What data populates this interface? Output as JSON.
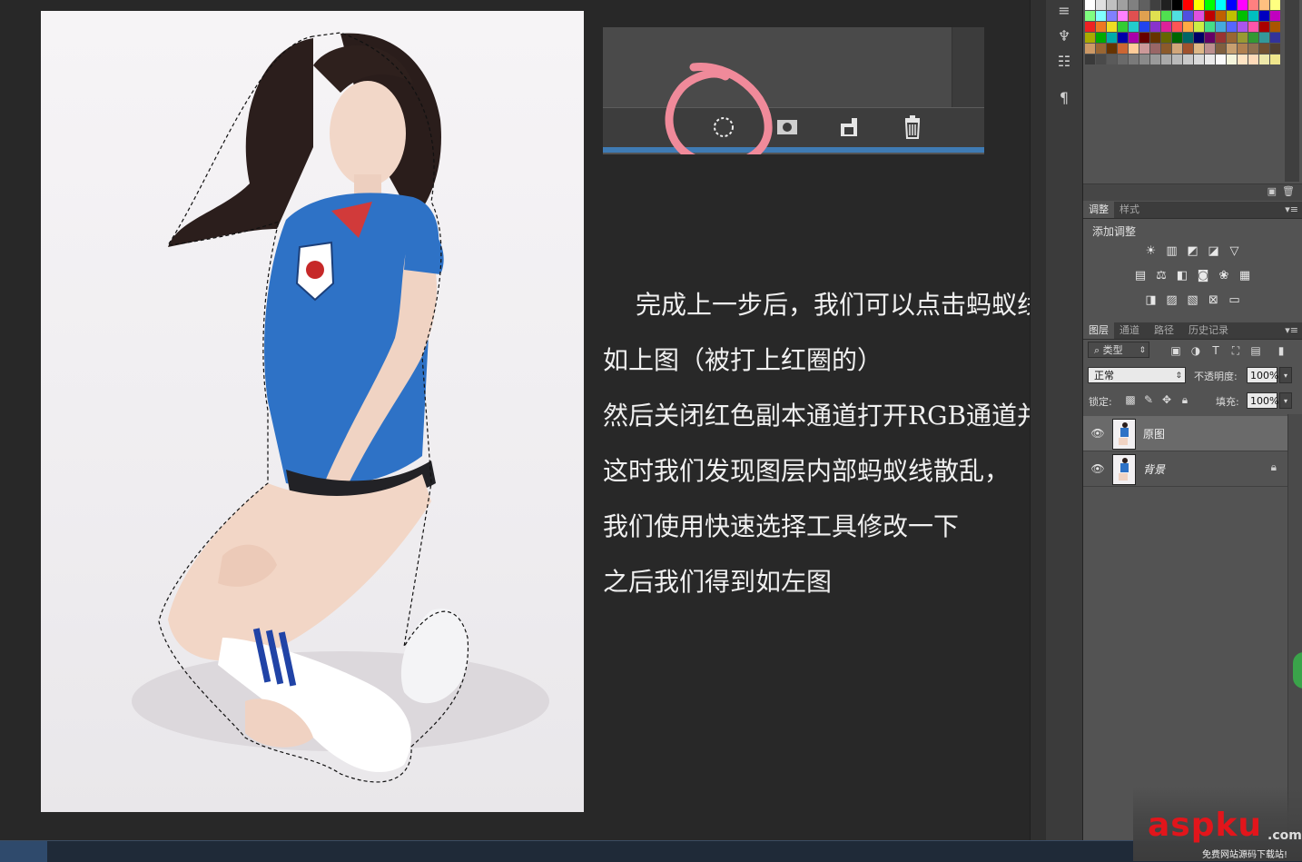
{
  "document": {
    "annotation_lines": [
      "完成上一步后，我们可以点击蚂蚁线了，",
      "如上图（被打上红圈的）",
      "然后关闭红色副本通道打开RGB通道并返回图层",
      "这时我们发现图层内部蚂蚁线散乱，",
      "我们使用快速选择工具修改一下",
      "之后我们得到如左图"
    ],
    "inset_buttons": [
      "load-selection-icon",
      "save-selection-icon",
      "new-channel-icon",
      "delete-channel-icon"
    ],
    "highlight_color": "#f08a9a"
  },
  "swatches": {
    "colors": [
      "#ffffff",
      "#e0e0e0",
      "#c0c0c0",
      "#a0a0a0",
      "#808080",
      "#606060",
      "#404040",
      "#202020",
      "#000000",
      "#ff0000",
      "#ffff00",
      "#00ff00",
      "#00ffff",
      "#0000ff",
      "#ff00ff",
      "#ff8080",
      "#ffc080",
      "#ffff80",
      "#80ff80",
      "#80ffff",
      "#8080ff",
      "#ff80ff",
      "#e05050",
      "#e0a050",
      "#e0e050",
      "#50e050",
      "#50e0e0",
      "#5050e0",
      "#e050e0",
      "#c00000",
      "#c06000",
      "#c0c000",
      "#00c000",
      "#00c0c0",
      "#0000c0",
      "#c000c0",
      "#ee2222",
      "#ee7722",
      "#eedd22",
      "#33cc33",
      "#22cccc",
      "#2244ee",
      "#8833cc",
      "#dd2299",
      "#ff5555",
      "#ffaa44",
      "#ccee44",
      "#44dd88",
      "#44aadd",
      "#5566ff",
      "#aa55ee",
      "#ff55aa",
      "#aa0000",
      "#aa5500",
      "#aaaa00",
      "#00aa00",
      "#00aaaa",
      "#0000aa",
      "#aa00aa",
      "#660000",
      "#663300",
      "#666600",
      "#006600",
      "#006666",
      "#000066",
      "#660066",
      "#993333",
      "#996633",
      "#999933",
      "#339933",
      "#339999",
      "#333399",
      "#cc9966",
      "#996633",
      "#663300",
      "#cc6633",
      "#ffcc99",
      "#cc9999",
      "#996666",
      "#8b5a2b",
      "#d2a679",
      "#a0522d",
      "#deb887",
      "#bc8f8f",
      "#7f5f3f",
      "#c8a070",
      "#b08050",
      "#907050",
      "#705030",
      "#504030",
      "#3a3a3a",
      "#4a4a4a",
      "#5a5a5a",
      "#6a6a6a",
      "#7a7a7a",
      "#8a8a8a",
      "#9a9a9a",
      "#aaaaaa",
      "#bababa",
      "#cacaca",
      "#dadada",
      "#eaeaea",
      "#fafafa",
      "#f5f5dc",
      "#ffe4c4",
      "#ffdab9",
      "#eee8aa",
      "#f0e68c"
    ]
  },
  "adjustments": {
    "tabs": [
      "调整",
      "样式"
    ],
    "title": "添加调整"
  },
  "layers_panel": {
    "tabs": [
      "图层",
      "通道",
      "路径",
      "历史记录"
    ],
    "filter_label": "类型",
    "blend_mode": "正常",
    "opacity_label": "不透明度:",
    "opacity_value": "100%",
    "lock_label": "锁定:",
    "fill_label": "填充:",
    "fill_value": "100%",
    "layers": [
      {
        "name": "原图",
        "selected": true,
        "locked": false
      },
      {
        "name": "背景",
        "selected": false,
        "locked": true
      }
    ]
  },
  "watermark": {
    "main": "aspku",
    "suffix": ".com",
    "subtitle": "免费网站源码下载站!"
  }
}
